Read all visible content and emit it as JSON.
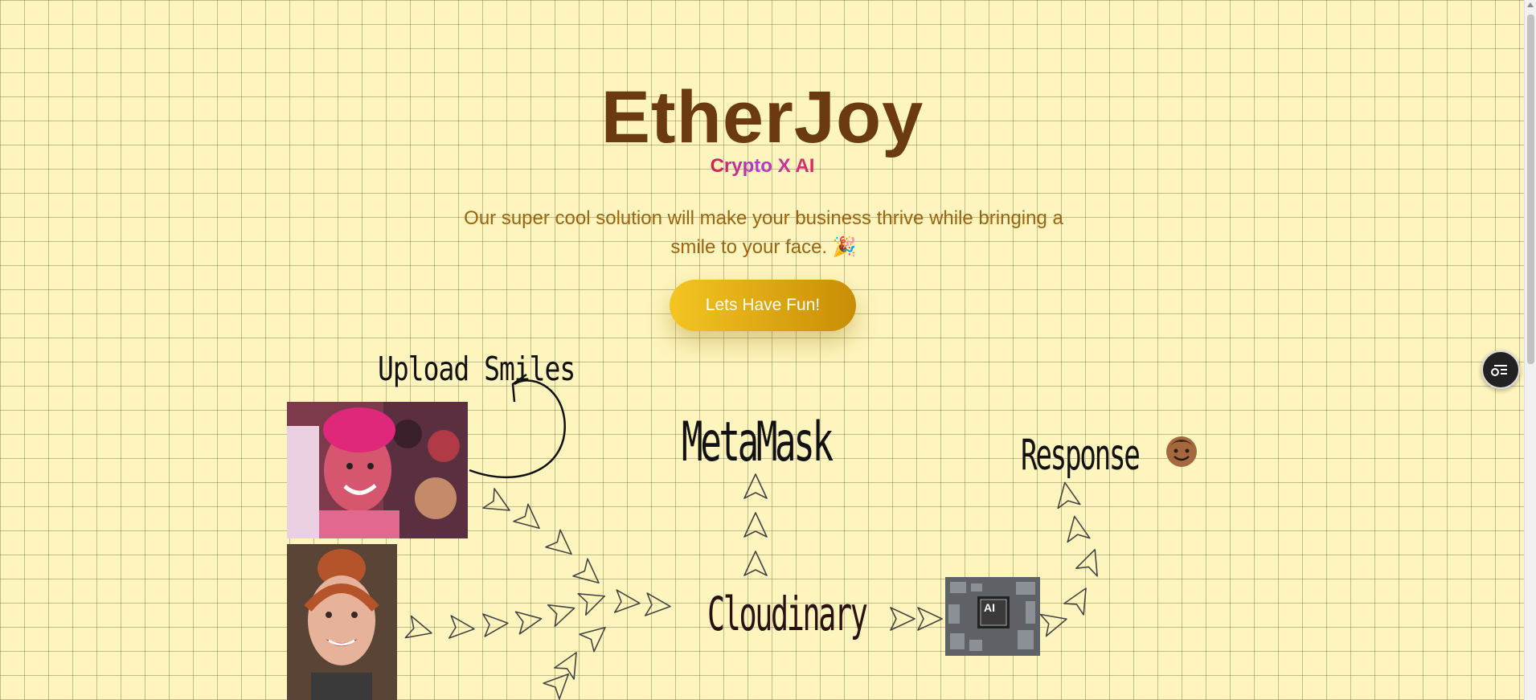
{
  "hero": {
    "title": "EtherJoy",
    "subtitle": "Crypto X AI",
    "tagline": "Our super cool solution will make your business thrive while bringing a smile to your face. 🎉",
    "cta_label": "Lets Have Fun!"
  },
  "diagram": {
    "upload_label": "Upload Smiles",
    "metamask_label": "MetaMask",
    "cloudinary_label": "Cloudinary",
    "response_label": "Response"
  },
  "icons": {
    "float_button": "settings-list-icon",
    "response_emoji": "smiling-face-icon",
    "tagline_emoji": "party-popper"
  },
  "colors": {
    "background": "#fdf5bd",
    "title": "#6b3a10",
    "tagline": "#9c6410",
    "cta_start": "#f3c522",
    "cta_end": "#c98d05"
  }
}
